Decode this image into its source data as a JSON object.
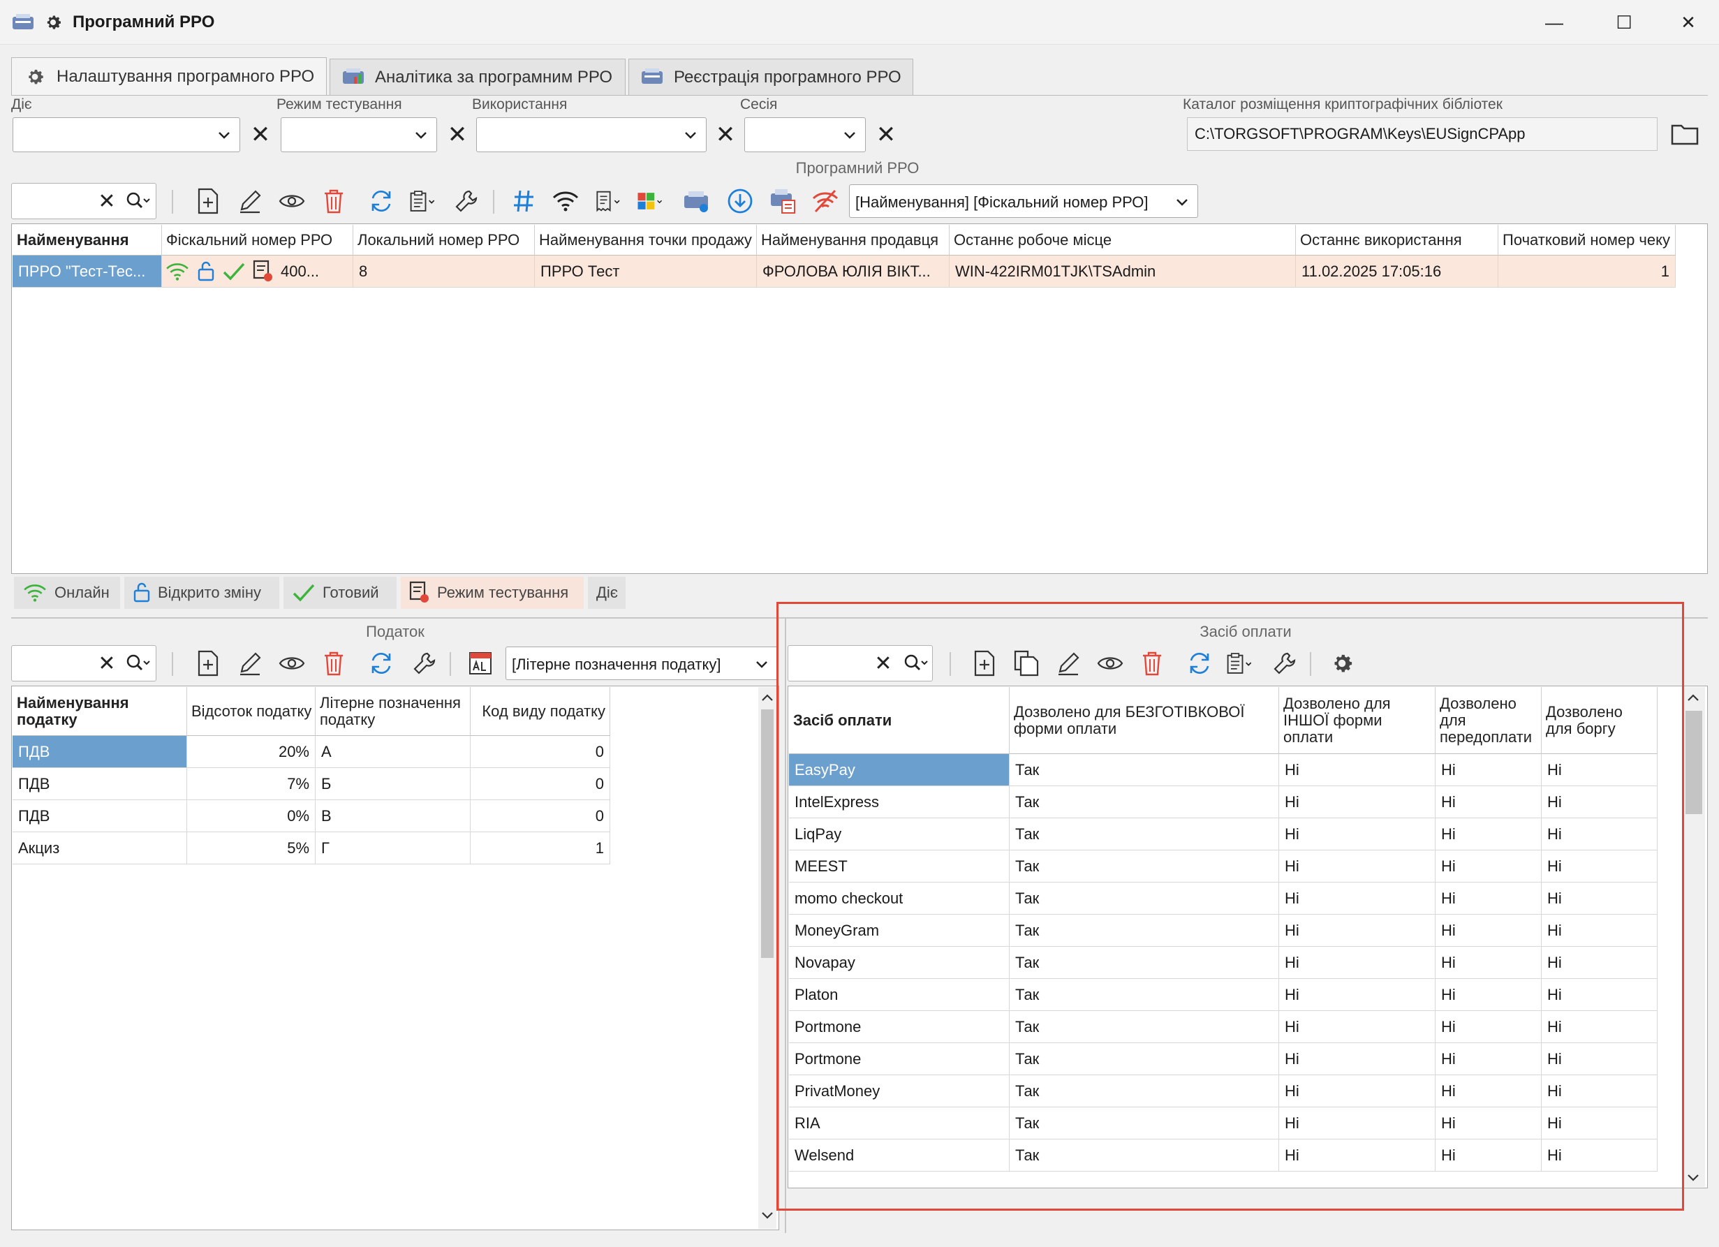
{
  "window": {
    "title": "Програмний РРО",
    "min": "—",
    "max": "☐",
    "close": "✕"
  },
  "tabs": [
    {
      "label": "Налаштування програмного РРО"
    },
    {
      "label": "Аналітика за програмним РРО"
    },
    {
      "label": "Реєстрація програмного РРО"
    }
  ],
  "filters": {
    "status_label": "Діє",
    "test_mode_label": "Режим тестування",
    "usage_label": "Використання",
    "session_label": "Сесія",
    "crypto_dir_label": "Каталог розміщення криптографічних бібліотек",
    "crypto_dir_value": "C:\\TORGSOFT\\PROGRAM\\Keys\\EUSignCPApp"
  },
  "rro": {
    "section_title": "Програмний РРО",
    "sort_combo": "[Найменування]  [Фіскальний номер РРО]",
    "columns": [
      "Найменування",
      "Фіскальний номер РРО",
      "Локальний номер РРО",
      "Найменування точки продажу",
      "Найменування продавця",
      "Останнє робоче місце",
      "Останнє використання",
      "Початковий номер чеку"
    ],
    "rows": [
      {
        "name": "ПРРО \"Тест-Тес...",
        "fiscal": "400...",
        "local": "8",
        "point": "ПРРО Тест",
        "seller": "ФРОЛОВА ЮЛІЯ ВІКТ...",
        "workplace": "WIN-422IRM01TJK\\TSAdmin",
        "last_used": "11.02.2025 17:05:16",
        "start_receipt": "1"
      }
    ]
  },
  "legend": [
    "Онлайн",
    "Відкрито зміну",
    "Готовий",
    "Режим тестування",
    "Діє"
  ],
  "tax": {
    "section_title": "Податок",
    "sort_combo": "[Літерне позначення податку]",
    "columns": [
      "Найменування податку",
      "Відсоток податку",
      "Літерне позначення податку",
      "Код виду податку"
    ],
    "rows": [
      {
        "name": "ПДВ",
        "pct": "20%",
        "letter": "А",
        "code": "0"
      },
      {
        "name": "ПДВ",
        "pct": "7%",
        "letter": "Б",
        "code": "0"
      },
      {
        "name": "ПДВ",
        "pct": "0%",
        "letter": "В",
        "code": "0"
      },
      {
        "name": "Акциз",
        "pct": "5%",
        "letter": "Г",
        "code": "1"
      }
    ]
  },
  "payment": {
    "section_title": "Засіб оплати",
    "columns": [
      "Засіб оплати",
      "Дозволено для БЕЗГОТІВКОВОЇ форми оплати",
      "Дозволено для ІНШОЇ форми оплати",
      "Дозволено для передоплати",
      "Дозволено для боргу"
    ],
    "rows": [
      {
        "name": "EasyPay",
        "cashless": "Так",
        "other": "Ні",
        "prepay": "Ні",
        "debt": "Ні"
      },
      {
        "name": "IntelExpress",
        "cashless": "Так",
        "other": "Ні",
        "prepay": "Ні",
        "debt": "Ні"
      },
      {
        "name": "LiqPay",
        "cashless": "Так",
        "other": "Ні",
        "prepay": "Ні",
        "debt": "Ні"
      },
      {
        "name": "MEEST",
        "cashless": "Так",
        "other": "Ні",
        "prepay": "Ні",
        "debt": "Ні"
      },
      {
        "name": "momo checkout",
        "cashless": "Так",
        "other": "Ні",
        "prepay": "Ні",
        "debt": "Ні"
      },
      {
        "name": "MoneyGram",
        "cashless": "Так",
        "other": "Ні",
        "prepay": "Ні",
        "debt": "Ні"
      },
      {
        "name": "Novapay",
        "cashless": "Так",
        "other": "Ні",
        "prepay": "Ні",
        "debt": "Ні"
      },
      {
        "name": "Platon",
        "cashless": "Так",
        "other": "Ні",
        "prepay": "Ні",
        "debt": "Ні"
      },
      {
        "name": "Portmone",
        "cashless": "Так",
        "other": "Ні",
        "prepay": "Ні",
        "debt": "Ні"
      },
      {
        "name": "Portmone",
        "cashless": "Так",
        "other": "Ні",
        "prepay": "Ні",
        "debt": "Ні"
      },
      {
        "name": "PrivatMoney",
        "cashless": "Так",
        "other": "Ні",
        "prepay": "Ні",
        "debt": "Ні"
      },
      {
        "name": "RIA",
        "cashless": "Так",
        "other": "Ні",
        "prepay": "Ні",
        "debt": "Ні"
      },
      {
        "name": "Welsend",
        "cashless": "Так",
        "other": "Ні",
        "prepay": "Ні",
        "debt": "Ні"
      }
    ]
  },
  "colors": {
    "selection": "#6a9fce",
    "row_highlight": "#fbe7dc",
    "annotation": "#e0483a",
    "wifi": "#3cb43c",
    "blue": "#1e7fd8",
    "red": "#e0483a"
  }
}
